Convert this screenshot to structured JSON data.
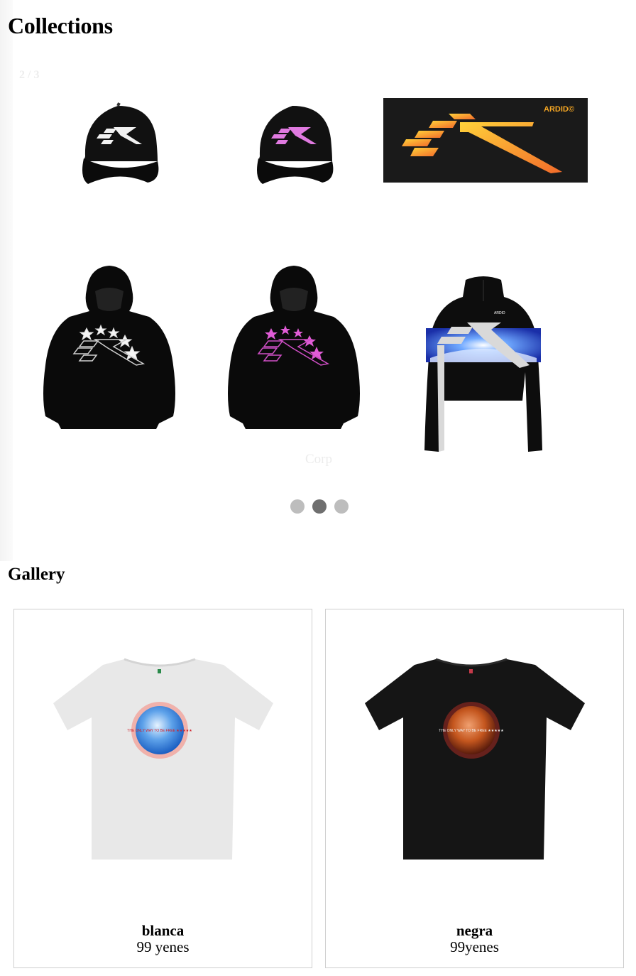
{
  "collections": {
    "title": "Collections",
    "counter": "2 / 3",
    "caption": "Corp",
    "banner_brand": "ARDID©",
    "jacket_label": "ARDID",
    "slides_total": 3,
    "slide_active": 2,
    "items": [
      {
        "kind": "cap",
        "logo_color": "#ffffff"
      },
      {
        "kind": "cap",
        "logo_color": "#e07ae0"
      },
      {
        "kind": "banner",
        "logo_color": "#f5a623"
      },
      {
        "kind": "hoodie",
        "logo_color": "#ffffff"
      },
      {
        "kind": "hoodie",
        "logo_color": "#e05cd6"
      },
      {
        "kind": "jacket",
        "logo_color": "#d9d9d9"
      }
    ]
  },
  "gallery": {
    "title": "Gallery",
    "shirt_text": "THE ONLY WAY TO BE FREE ★★★★★",
    "cards": [
      {
        "name": "blanca",
        "price": "99 yenes",
        "shirt_color": "#e8e8e8",
        "planet": "blue"
      },
      {
        "name": "negra",
        "price": "99yenes",
        "shirt_color": "#151515",
        "planet": "red"
      }
    ]
  }
}
